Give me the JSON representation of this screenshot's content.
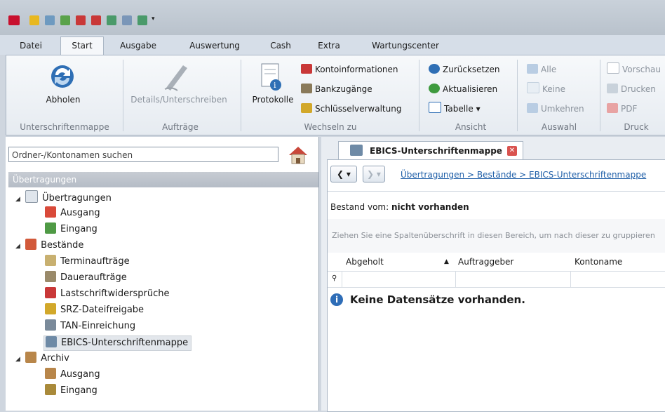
{
  "menu_tabs": [
    "Datei",
    "Start",
    "Ausgabe",
    "Auswertung",
    "Cash",
    "Extra",
    "Wartungscenter"
  ],
  "ribbon": {
    "abholen": "Abholen",
    "details": "Details/Unterschreiben",
    "protokolle": "Protokolle",
    "kontoinformationen": "Kontoinformationen",
    "bankzugaenge": "Bankzugänge",
    "schluessel": "Schlüsselverwaltung",
    "zuruecksetzen": "Zurücksetzen",
    "aktualisieren": "Aktualisieren",
    "tabelle": "Tabelle ▾",
    "alle": "Alle",
    "keine": "Keine",
    "umkehren": "Umkehren",
    "vorschau": "Vorschau",
    "drucken": "Drucken",
    "pdf": "PDF",
    "groups": [
      "Unterschriftenmappe",
      "Aufträge",
      "Wechseln zu",
      "Ansicht",
      "Auswahl",
      "Druck"
    ]
  },
  "left": {
    "search_placeholder": "Ordner-/Kontonamen suchen",
    "section": "Übertragungen",
    "tree": {
      "uebertragungen": "Übertragungen",
      "ausgang1": "Ausgang",
      "eingang1": "Eingang",
      "bestaende": "Bestände",
      "termin": "Terminaufträge",
      "dauer": "Daueraufträge",
      "last": "Lastschriftwidersprüche",
      "srz": "SRZ-Dateifreigabe",
      "tan": "TAN-Einreichung",
      "ebics": "EBICS-Unterschriftenmappe",
      "archiv": "Archiv",
      "ausgang2": "Ausgang",
      "eingang2": "Eingang"
    }
  },
  "right": {
    "tab_title": "EBICS-Unterschriftenmappe",
    "breadcrumb": "Übertragungen > Bestände > EBICS-Unterschriftenmappe",
    "bestand_label": "Bestand vom: ",
    "bestand_value": "nicht vorhanden",
    "group_hint": "Ziehen Sie eine Spaltenüberschrift in diesen Bereich, um nach dieser zu gruppieren",
    "col1": "Abgeholt",
    "col2": "Auftraggeber",
    "col3": "Kontoname",
    "empty": "Keine Datensätze vorhanden."
  }
}
